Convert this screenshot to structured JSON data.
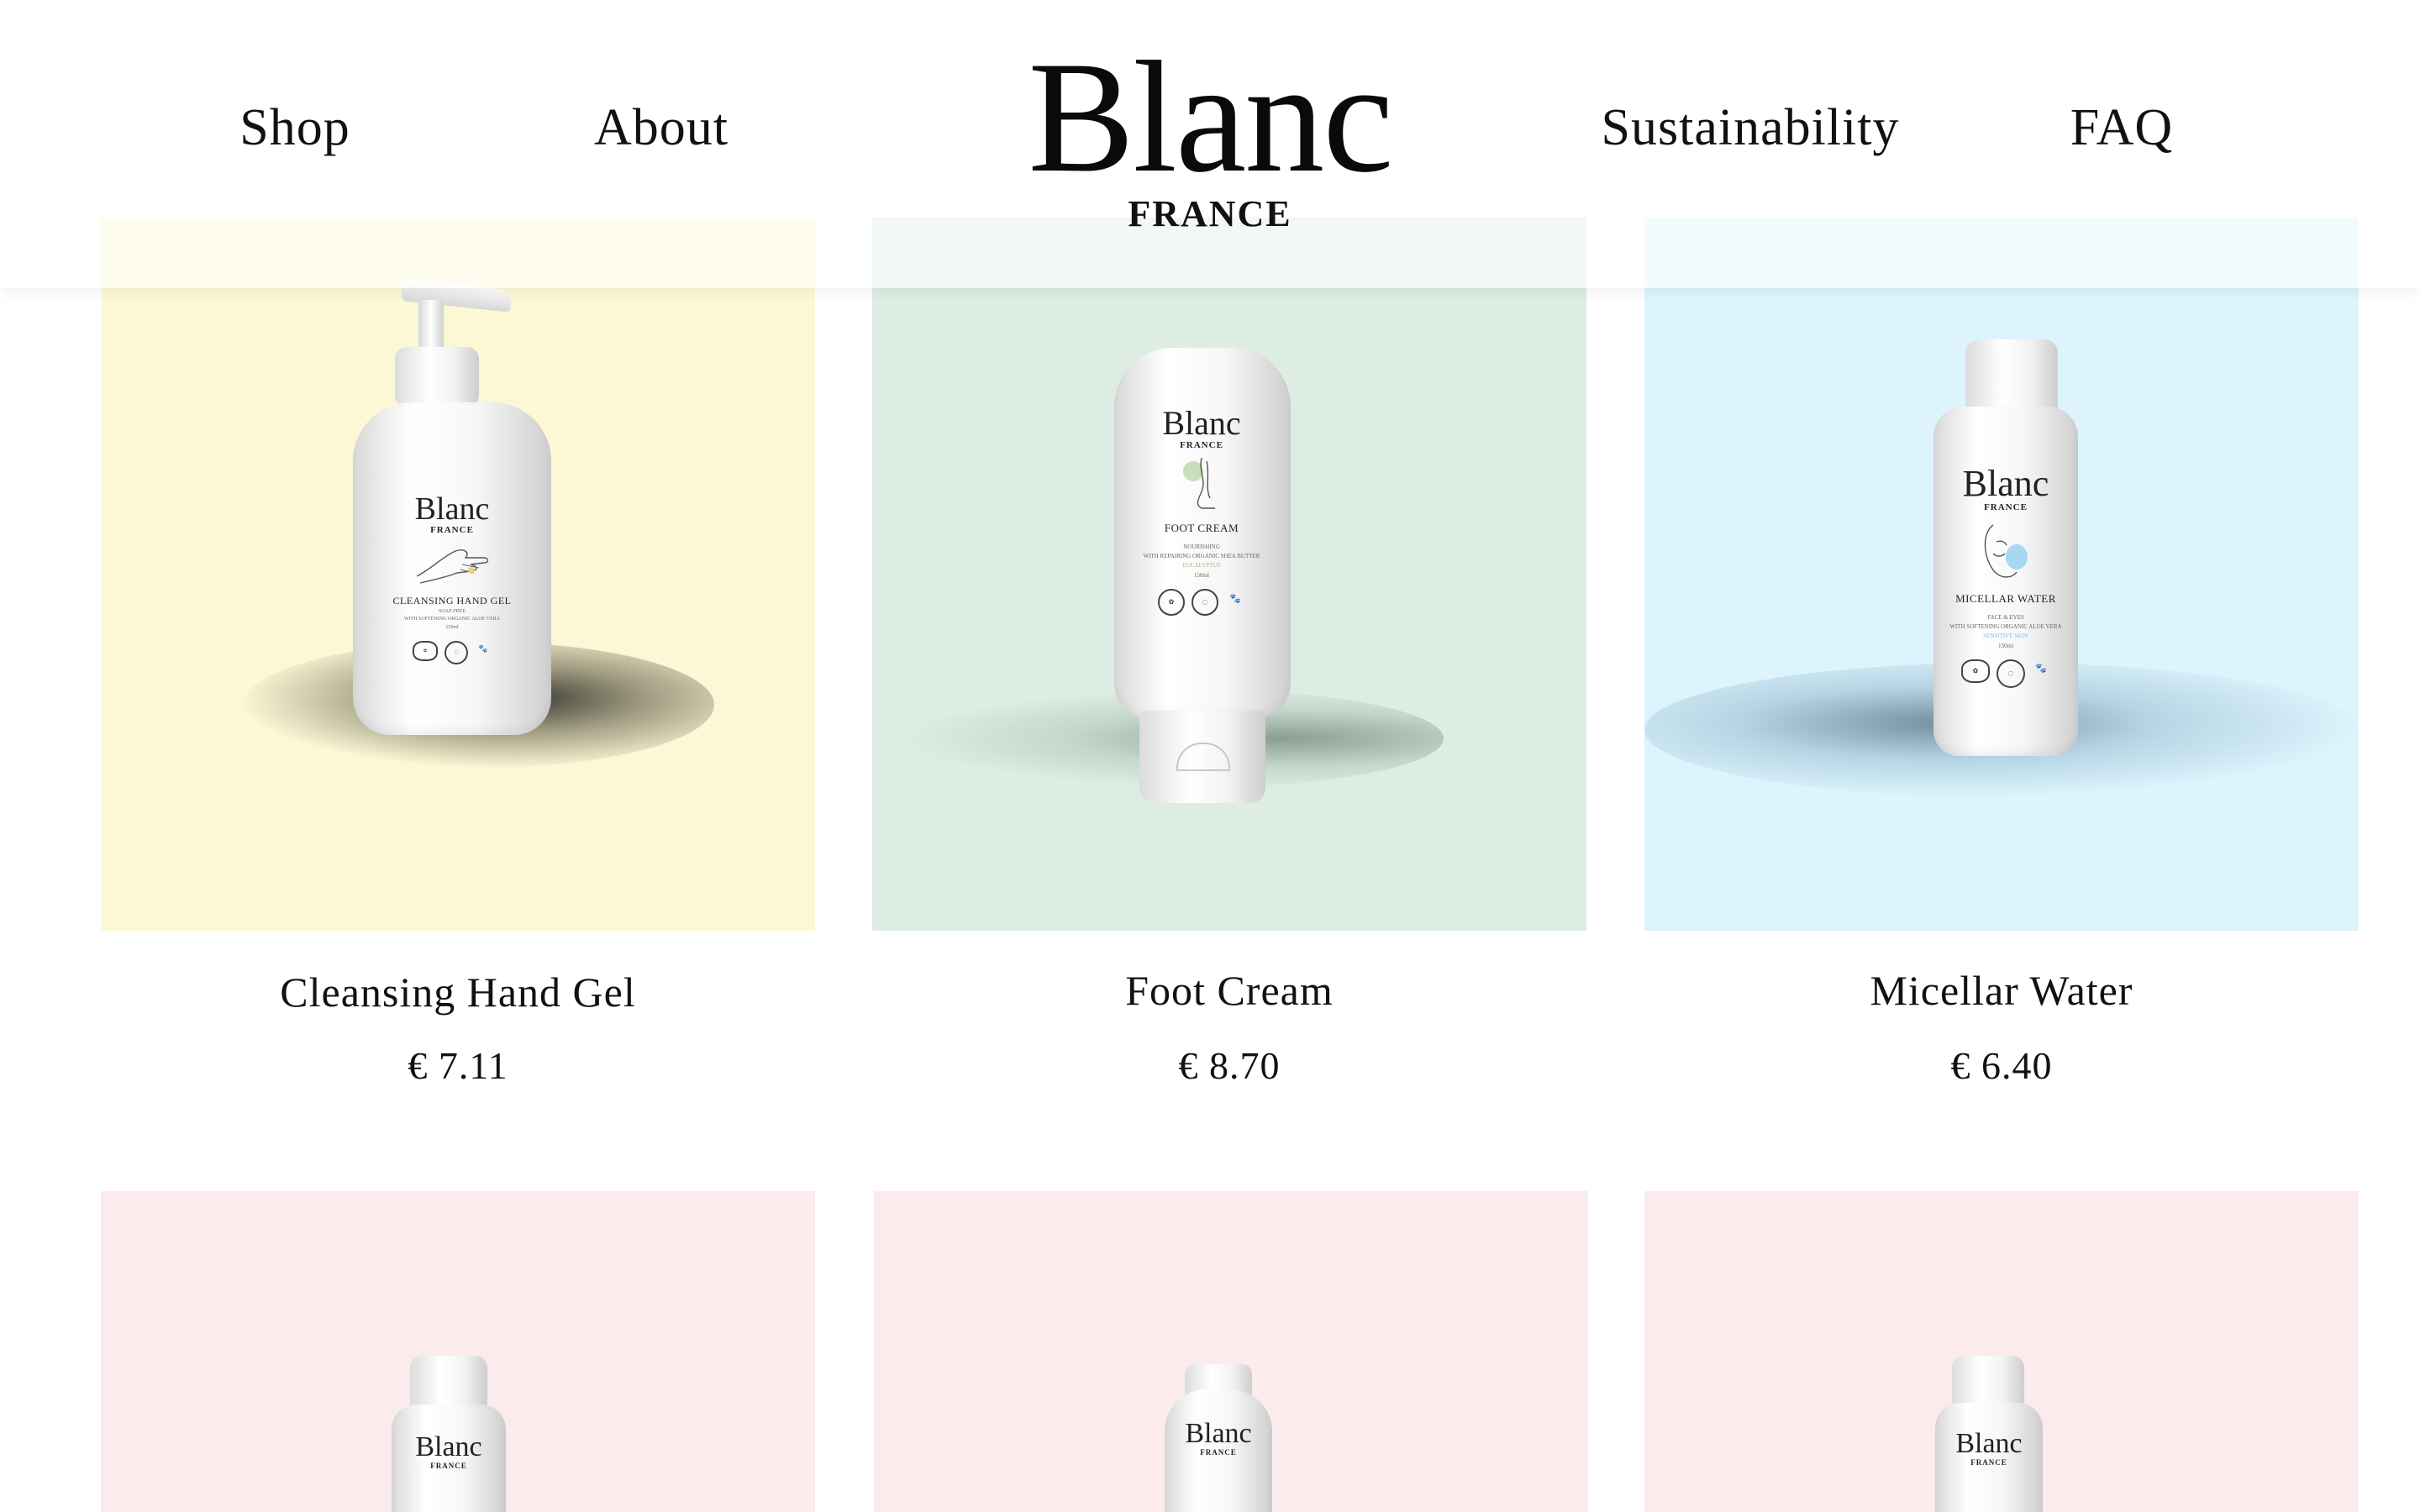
{
  "header": {
    "nav": {
      "shop": "Shop",
      "about": "About",
      "sustainability": "Sustainability",
      "faq": "FAQ"
    },
    "logo": {
      "word": "Blanc",
      "sub": "FRANCE"
    }
  },
  "products": [
    {
      "name": "Cleansing Hand Gel",
      "price": "€ 7.11",
      "background": "#fcf8d6",
      "label": {
        "brand": "Blanc",
        "brand_sub": "FRANCE",
        "product": "CLEANSING HAND GEL",
        "line1": "SOAP-FREE",
        "line2": "WITH SOFTENING ORGANIC ALOE VERA",
        "line3": "150ml"
      }
    },
    {
      "name": "Foot Cream",
      "price": "€ 8.70",
      "background": "#ddede3",
      "label": {
        "brand": "Blanc",
        "brand_sub": "FRANCE",
        "product": "FOOT CREAM",
        "line1": "NOURISHING",
        "line2": "WITH REPAIRING ORGANIC SHEA BUTTER",
        "line3": "EUCALYPTUS",
        "line4": "150ml"
      }
    },
    {
      "name": "Micellar Water",
      "price": "€ 6.40",
      "background": "#ddf4fd",
      "label": {
        "brand": "Blanc",
        "brand_sub": "FRANCE",
        "product": "MICELLAR WATER",
        "line1": "FACE & EYES",
        "line2": "WITH SOFTENING ORGANIC ALOE VERA",
        "line3": "SENSITIVE SKIN",
        "line4": "150ml"
      }
    },
    {
      "background": "#fbebec",
      "label": {
        "brand": "Blanc",
        "brand_sub": "FRANCE"
      }
    },
    {
      "background": "#fbebec",
      "label": {
        "brand": "Blanc",
        "brand_sub": "FRANCE"
      }
    },
    {
      "background": "#fbebec",
      "label": {
        "brand": "Blanc",
        "brand_sub": "FRANCE"
      }
    }
  ]
}
